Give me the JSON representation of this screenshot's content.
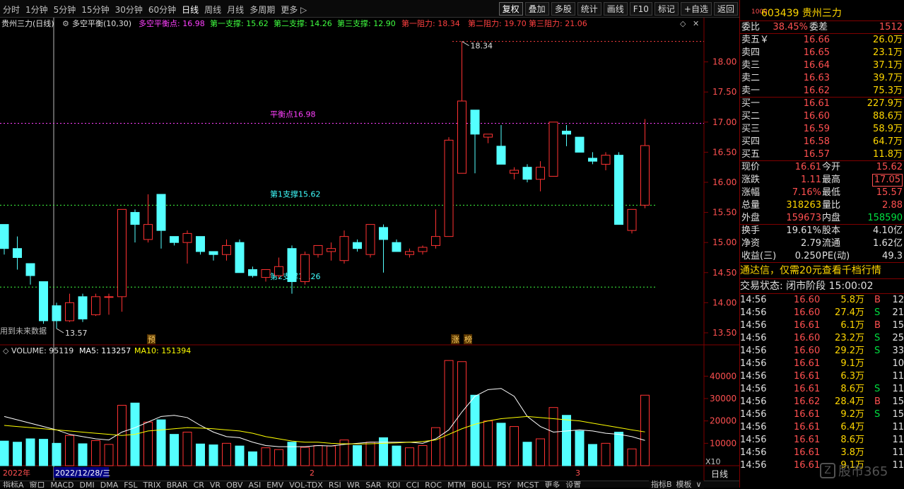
{
  "toolbar": {
    "periods": [
      "分时",
      "1分钟",
      "5分钟",
      "15分钟",
      "30分钟",
      "60分钟",
      "日线",
      "周线",
      "月线",
      "多周期",
      "更多 ▷"
    ],
    "active_period": "日线",
    "buttons": [
      "复权",
      "叠加",
      "多股",
      "统计",
      "画线",
      "F10",
      "标记",
      "+自选",
      "返回"
    ]
  },
  "chart_header": {
    "title": "贵州三力(日线)",
    "indicator": "多空平衡(10,30)",
    "balance": "多空平衡点: 16.98",
    "s1": "第一支撑: 15.62",
    "s2": "第二支撑: 14.26",
    "s3": "第三支撑: 12.90",
    "r1": "第一阻力: 18.34",
    "r2": "第二阻力: 19.70",
    "r3": "第三阻力: 21.06"
  },
  "annotations": {
    "balance_label": "平衡点16.98",
    "support1_label": "第1支撑15.62",
    "support2_label": "第2支撑14.26",
    "high_label": "18.34",
    "low_label": "13.57",
    "future_note": "用到未来数据",
    "marker_yu": "预",
    "marker_zhang": "涨",
    "marker_bang": "榜"
  },
  "volume_header": {
    "volume": "VOLUME: 95119",
    "ma5": "MA5: 113257",
    "ma10": "MA10: 151394"
  },
  "price_axis": [
    "18.00",
    "17.50",
    "17.00",
    "16.50",
    "16.00",
    "15.50",
    "15.00",
    "14.50",
    "14.00",
    "13.50"
  ],
  "volume_axis": [
    "40000",
    "30000",
    "20000",
    "10000"
  ],
  "volume_unit": "X10",
  "date_axis": {
    "year": "2022年",
    "cursor_date": "2022/12/28/三",
    "m2": "2",
    "m3": "3",
    "period": "日线"
  },
  "colors": {
    "up": "#ff3232",
    "down": "#54ffff",
    "ma5": "#ffffff",
    "ma10": "#ffff00",
    "balance": "#ff40ff",
    "support": "#40ff40",
    "resistance": "#ff4040",
    "grid": "#800000"
  },
  "chart_data": {
    "type": "candlestick",
    "ylim": [
      13.3,
      18.5
    ],
    "lines": {
      "balance": 16.98,
      "support1": 15.62,
      "support2": 14.26,
      "resistance1": 18.34
    },
    "candles": [
      {
        "o": 15.3,
        "h": 15.3,
        "l": 14.8,
        "c": 14.9
      },
      {
        "o": 14.9,
        "h": 15.1,
        "l": 14.55,
        "c": 14.75
      },
      {
        "o": 14.65,
        "h": 14.65,
        "l": 14.3,
        "c": 14.45
      },
      {
        "o": 14.35,
        "h": 14.35,
        "l": 13.65,
        "c": 13.7
      },
      {
        "o": 13.95,
        "h": 14.0,
        "l": 13.57,
        "c": 13.7
      },
      {
        "o": 13.7,
        "h": 14.15,
        "l": 13.68,
        "c": 14.0
      },
      {
        "o": 14.1,
        "h": 14.15,
        "l": 13.68,
        "c": 13.73
      },
      {
        "o": 13.8,
        "h": 14.15,
        "l": 13.78,
        "c": 14.1
      },
      {
        "o": 14.1,
        "h": 14.15,
        "l": 13.8,
        "c": 14.1
      },
      {
        "o": 14.1,
        "h": 15.55,
        "l": 13.85,
        "c": 15.55
      },
      {
        "o": 15.5,
        "h": 15.55,
        "l": 15.0,
        "c": 15.3
      },
      {
        "o": 15.05,
        "h": 15.8,
        "l": 15.0,
        "c": 15.3
      },
      {
        "o": 15.8,
        "h": 15.8,
        "l": 14.9,
        "c": 15.2
      },
      {
        "o": 15.1,
        "h": 15.1,
        "l": 14.95,
        "c": 15.0
      },
      {
        "o": 15.0,
        "h": 15.2,
        "l": 14.65,
        "c": 15.15
      },
      {
        "o": 15.1,
        "h": 15.1,
        "l": 14.8,
        "c": 14.85
      },
      {
        "o": 14.85,
        "h": 14.85,
        "l": 14.7,
        "c": 14.8
      },
      {
        "o": 14.8,
        "h": 15.05,
        "l": 14.7,
        "c": 14.95
      },
      {
        "o": 15.0,
        "h": 15.05,
        "l": 14.5,
        "c": 14.5
      },
      {
        "o": 14.55,
        "h": 14.6,
        "l": 14.42,
        "c": 14.45
      },
      {
        "o": 14.42,
        "h": 14.55,
        "l": 14.35,
        "c": 14.55
      },
      {
        "o": 14.45,
        "h": 14.75,
        "l": 14.4,
        "c": 14.6
      },
      {
        "o": 14.9,
        "h": 14.95,
        "l": 14.15,
        "c": 14.35
      },
      {
        "o": 14.35,
        "h": 14.85,
        "l": 14.3,
        "c": 14.8
      },
      {
        "o": 14.8,
        "h": 14.95,
        "l": 14.75,
        "c": 14.95
      },
      {
        "o": 14.85,
        "h": 15.0,
        "l": 14.7,
        "c": 14.9
      },
      {
        "o": 14.7,
        "h": 15.2,
        "l": 14.65,
        "c": 15.1
      },
      {
        "o": 15.0,
        "h": 15.05,
        "l": 14.85,
        "c": 14.9
      },
      {
        "o": 14.8,
        "h": 15.3,
        "l": 14.75,
        "c": 15.3
      },
      {
        "o": 15.25,
        "h": 15.3,
        "l": 14.5,
        "c": 15.05
      },
      {
        "o": 15.0,
        "h": 15.05,
        "l": 14.85,
        "c": 14.85
      },
      {
        "o": 14.8,
        "h": 14.9,
        "l": 14.75,
        "c": 14.85
      },
      {
        "o": 14.85,
        "h": 14.95,
        "l": 14.8,
        "c": 14.92
      },
      {
        "o": 14.95,
        "h": 15.55,
        "l": 14.9,
        "c": 15.1
      },
      {
        "o": 15.1,
        "h": 16.75,
        "l": 15.1,
        "c": 16.7
      },
      {
        "o": 16.15,
        "h": 18.34,
        "l": 16.15,
        "c": 17.35
      },
      {
        "o": 17.2,
        "h": 17.2,
        "l": 16.15,
        "c": 16.8
      },
      {
        "o": 16.75,
        "h": 16.8,
        "l": 16.65,
        "c": 16.8
      },
      {
        "o": 16.6,
        "h": 16.95,
        "l": 16.3,
        "c": 16.3
      },
      {
        "o": 16.15,
        "h": 16.25,
        "l": 16.05,
        "c": 16.2
      },
      {
        "o": 16.25,
        "h": 16.3,
        "l": 16.0,
        "c": 16.05
      },
      {
        "o": 16.05,
        "h": 16.35,
        "l": 15.85,
        "c": 16.25
      },
      {
        "o": 16.1,
        "h": 17.0,
        "l": 16.1,
        "c": 17.0
      },
      {
        "o": 16.85,
        "h": 16.95,
        "l": 16.6,
        "c": 16.8
      },
      {
        "o": 16.75,
        "h": 16.75,
        "l": 16.5,
        "c": 16.5
      },
      {
        "o": 16.4,
        "h": 16.5,
        "l": 16.3,
        "c": 16.35
      },
      {
        "o": 16.3,
        "h": 16.5,
        "l": 16.2,
        "c": 16.45
      },
      {
        "o": 16.45,
        "h": 16.5,
        "l": 15.3,
        "c": 15.3
      },
      {
        "o": 15.2,
        "h": 15.55,
        "l": 15.15,
        "c": 15.55
      },
      {
        "o": 15.62,
        "h": 17.05,
        "l": 15.57,
        "c": 16.61
      }
    ],
    "volumes": [
      11000,
      10500,
      12000,
      11800,
      10000,
      13500,
      9800,
      11200,
      9500,
      27000,
      28000,
      19500,
      20500,
      14000,
      15000,
      9700,
      9300,
      10000,
      8800,
      6200,
      8000,
      7200,
      10500,
      8200,
      9000,
      8800,
      11500,
      9000,
      10500,
      12500,
      8800,
      8000,
      9000,
      17000,
      47000,
      46500,
      31500,
      20000,
      19000,
      17500,
      10500,
      12000,
      26000,
      22500,
      15500,
      9500,
      10000,
      15000,
      7500,
      31500
    ],
    "ma5": [
      22000,
      20500,
      19000,
      17500,
      16000,
      14000,
      13000,
      12000,
      11500,
      15000,
      17000,
      19500,
      22000,
      22500,
      21500,
      18000,
      15000,
      13000,
      12500,
      10500,
      9000,
      8500,
      8500,
      8500,
      9000,
      8800,
      9500,
      10000,
      10500,
      10500,
      10500,
      10500,
      10000,
      12000,
      16000,
      24000,
      31000,
      34000,
      34500,
      31000,
      22000,
      17500,
      15000,
      15500,
      16000,
      15500,
      14500,
      14000,
      13000,
      11300
    ],
    "ma10": [
      18000,
      17500,
      17000,
      16500,
      16000,
      15500,
      15000,
      14500,
      14000,
      13500,
      14000,
      15500,
      16000,
      16500,
      17000,
      16800,
      16500,
      16000,
      15500,
      14500,
      13000,
      12000,
      11000,
      10500,
      10500,
      10000,
      9800,
      9700,
      9800,
      10000,
      10200,
      10500,
      10800,
      11500,
      14000,
      16500,
      18500,
      20000,
      21000,
      21500,
      22000,
      21500,
      21000,
      20500,
      20000,
      19000,
      18000,
      17000,
      16000,
      15100
    ]
  },
  "quote": {
    "tag": "1000",
    "code": "603439",
    "name": "贵州三力",
    "webi_label": "委比",
    "webi": "38.45%",
    "weicha_label": "委差",
    "weicha": "1512",
    "asks": [
      {
        "label": "卖五￥",
        "price": "16.66",
        "vol": "26.0万"
      },
      {
        "label": "卖四",
        "price": "16.65",
        "vol": "23.1万"
      },
      {
        "label": "卖三",
        "price": "16.64",
        "vol": "37.1万"
      },
      {
        "label": "卖二",
        "price": "16.63",
        "vol": "39.7万"
      },
      {
        "label": "卖一",
        "price": "16.62",
        "vol": "75.3万"
      }
    ],
    "bids": [
      {
        "label": "买一",
        "price": "16.61",
        "vol": "227.9万"
      },
      {
        "label": "买二",
        "price": "16.60",
        "vol": "88.6万"
      },
      {
        "label": "买三",
        "price": "16.59",
        "vol": "58.9万"
      },
      {
        "label": "买四",
        "price": "16.58",
        "vol": "64.7万"
      },
      {
        "label": "买五",
        "price": "16.57",
        "vol": "11.8万"
      }
    ],
    "stats": [
      {
        "l1": "现价",
        "v1": "16.61",
        "l2": "今开",
        "v2": "15.62",
        "c1": "red",
        "c2": "red"
      },
      {
        "l1": "涨跌",
        "v1": "1.11",
        "l2": "最高",
        "v2": "17.05",
        "c1": "red",
        "c2": "red",
        "box2": true
      },
      {
        "l1": "涨幅",
        "v1": "7.16%",
        "l2": "最低",
        "v2": "15.57",
        "c1": "red",
        "c2": "red"
      },
      {
        "l1": "总量",
        "v1": "318263",
        "l2": "量比",
        "v2": "2.88",
        "c1": "gold",
        "c2": "red"
      },
      {
        "l1": "外盘",
        "v1": "159673",
        "l2": "内盘",
        "v2": "158590",
        "c1": "red",
        "c2": "green"
      }
    ],
    "fund": [
      {
        "l1": "换手",
        "v1": "19.61%",
        "l2": "股本",
        "v2": "4.10亿"
      },
      {
        "l1": "净资",
        "v1": "2.79",
        "l2": "流通",
        "v2": "1.62亿"
      },
      {
        "l1": "收益(三)",
        "v1": "0.250",
        "l2": "PE(动)",
        "v2": "49.3"
      }
    ],
    "promo": "通达信，仅需20元查看千档行情",
    "status": "交易状态: 闭市阶段 15:00:02",
    "ticks": [
      {
        "t": "14:56",
        "p": "16.60",
        "v": "5.8万",
        "d": "B",
        "n": "12"
      },
      {
        "t": "14:56",
        "p": "16.60",
        "v": "27.4万",
        "d": "S",
        "n": "21"
      },
      {
        "t": "14:56",
        "p": "16.61",
        "v": "6.1万",
        "d": "B",
        "n": "15"
      },
      {
        "t": "14:56",
        "p": "16.60",
        "v": "23.2万",
        "d": "S",
        "n": "25"
      },
      {
        "t": "14:56",
        "p": "16.60",
        "v": "29.2万",
        "d": "S",
        "n": "33"
      },
      {
        "t": "14:56",
        "p": "16.61",
        "v": "9.1万",
        "d": "",
        "n": "10"
      },
      {
        "t": "14:56",
        "p": "16.61",
        "v": "6.3万",
        "d": "",
        "n": "11"
      },
      {
        "t": "14:56",
        "p": "16.61",
        "v": "8.6万",
        "d": "S",
        "n": "11"
      },
      {
        "t": "14:56",
        "p": "16.62",
        "v": "28.4万",
        "d": "B",
        "n": "15"
      },
      {
        "t": "14:56",
        "p": "16.61",
        "v": "9.2万",
        "d": "S",
        "n": "15"
      },
      {
        "t": "14:56",
        "p": "16.61",
        "v": "6.4万",
        "d": "",
        "n": "11"
      },
      {
        "t": "14:56",
        "p": "16.61",
        "v": "8.6万",
        "d": "",
        "n": "11"
      },
      {
        "t": "14:56",
        "p": "16.61",
        "v": "3.8万",
        "d": "",
        "n": "11"
      },
      {
        "t": "14:56",
        "p": "16.61",
        "v": "9.1万",
        "d": "",
        "n": "11"
      }
    ]
  },
  "bottom_tabs": [
    "指标A",
    "窗口",
    "MACD",
    "DMI",
    "DMA",
    "FSL",
    "TRIX",
    "BRAR",
    "CR",
    "VR",
    "OBV",
    "ASI",
    "EMV",
    "VOL-TDX",
    "RSI",
    "WR",
    "SAR",
    "KDJ",
    "CCI",
    "ROC",
    "MTM",
    "BOLL",
    "PSY",
    "MCST",
    "更多",
    "设置"
  ],
  "bottom_right": [
    "指标B",
    "模板",
    "∨"
  ],
  "watermark": "股市365"
}
